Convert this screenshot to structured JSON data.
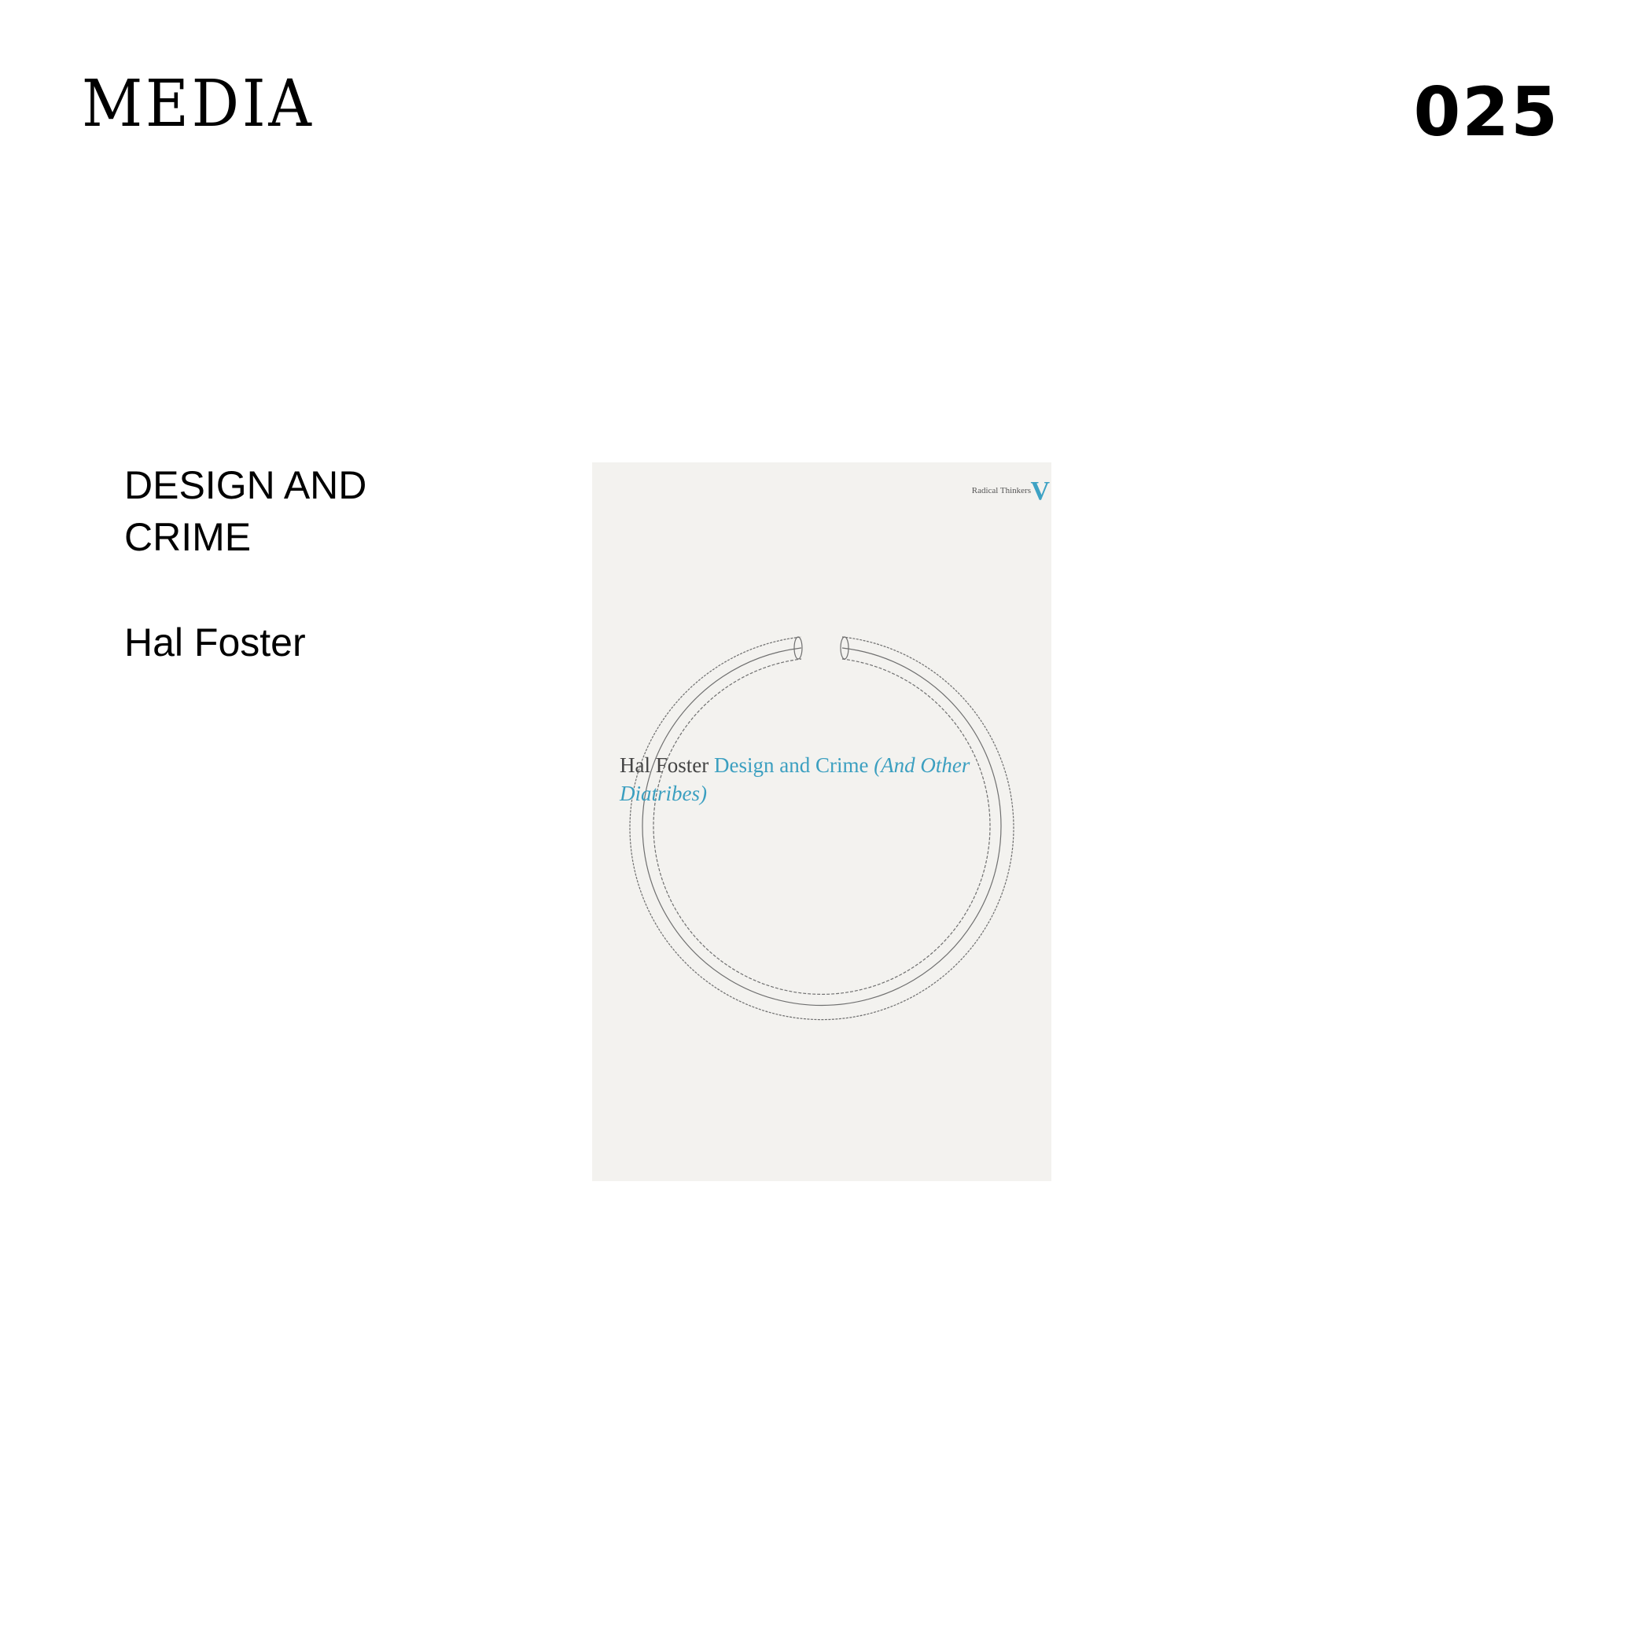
{
  "header": {
    "brand": "MEDIA",
    "issue_number": "025"
  },
  "book": {
    "title": "DESIGN AND CRIME",
    "author": "Hal Foster"
  },
  "cover": {
    "series": "Radical Thinkers",
    "series_mark": "V",
    "author": "Hal Foster",
    "title": "Design and Crime",
    "subtitle": "(And Other Diatribes)",
    "background_color": "#f3f2ef",
    "accent_color": "#3da2c4"
  }
}
